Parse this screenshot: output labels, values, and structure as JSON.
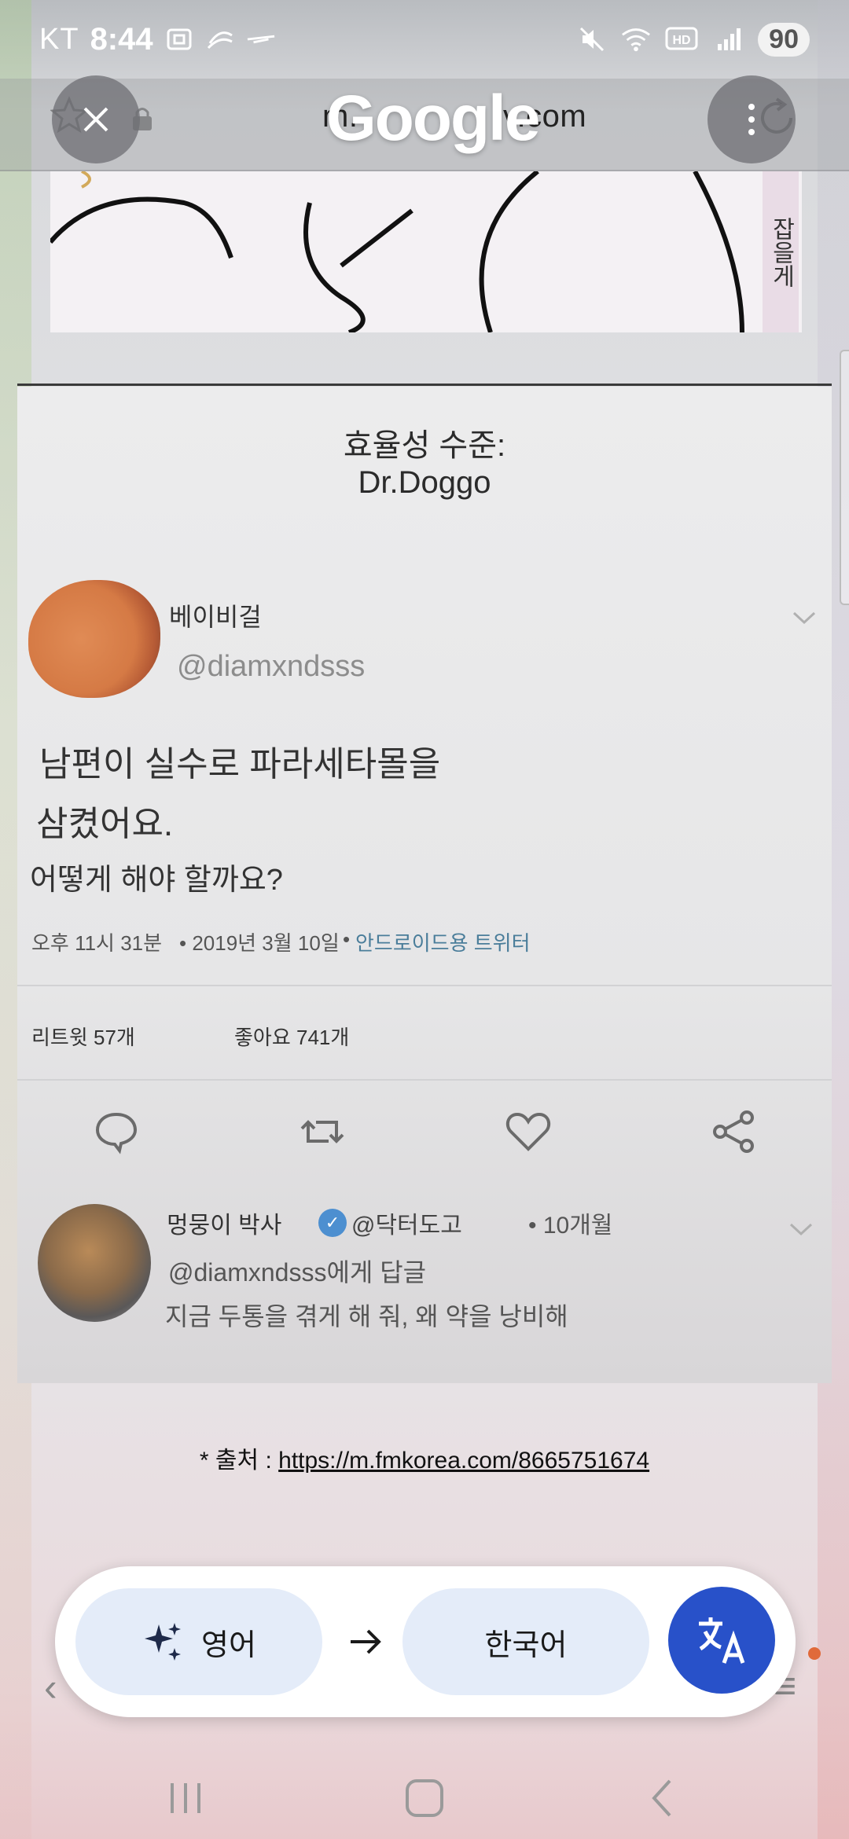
{
  "status_bar": {
    "carrier": "KT",
    "time": "8:44",
    "battery": "90",
    "hd_label": "HD"
  },
  "browser": {
    "url": "m.fmkorea.com",
    "url_visible": "m.",
    "url_visible_end": "v.com",
    "logo": "Google"
  },
  "comic": {
    "side_text": "잡을게"
  },
  "post": {
    "title_line1": "효율성 수준:",
    "title_line2": "Dr.Doggo",
    "author_name": "베이비걸",
    "author_handle": "@diamxndsss",
    "tweet_line1": "남편이 실수로 파라세타몰을",
    "tweet_line2": "삼켰어요.",
    "tweet_line3": "어떻게 해야 할까요?",
    "meta_time": "오후 11시 31분",
    "meta_date": "• 2019년 3월 10일",
    "meta_source_dot": "•",
    "meta_source": "안드로이드용 트위터",
    "retweets": "리트윗 57개",
    "likes": "좋아요 741개"
  },
  "reply": {
    "name": "멍뭉이 박사",
    "handle": "@닥터도고",
    "time": "• 10개월",
    "reply_to": "@diamxndsss에게 답글",
    "body": "지금 두통을 겪게 해 줘, 왜 약을 낭비해"
  },
  "source": {
    "prefix": "* 출처 : ",
    "link": "https://m.fmkorea.com/8665751674"
  },
  "translate": {
    "source_lang": "영어",
    "target_lang": "한국어"
  },
  "colors": {
    "translate_fab": "#2851c9",
    "lang_chip": "#e4ecf9",
    "link_blue": "#4a7d9a"
  }
}
